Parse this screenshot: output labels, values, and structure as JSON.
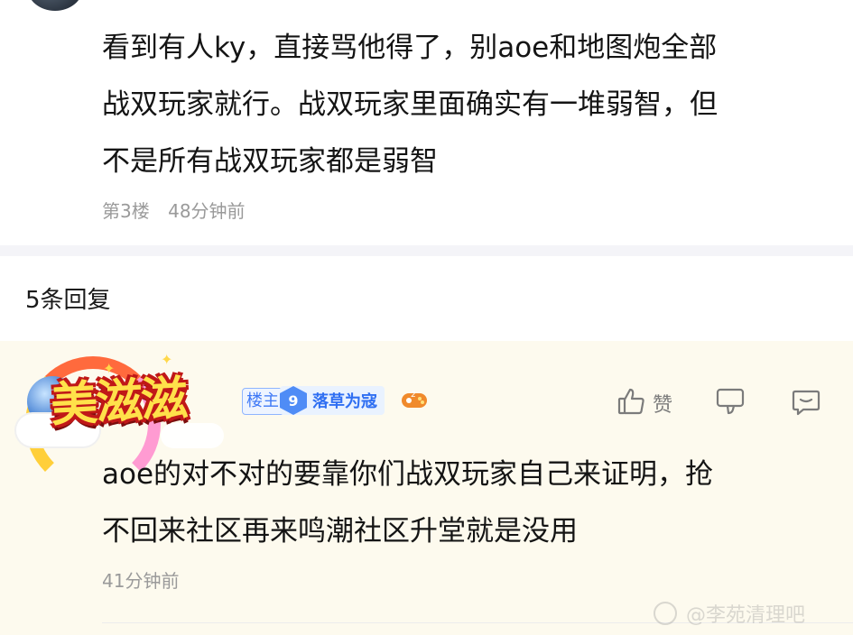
{
  "post": {
    "body_lines": [
      "看到有人ky，直接骂他得了，别aoe和地图炮全部",
      "战双玩家就行。战双玩家里面确实有一堆弱智，但",
      "不是所有战双玩家都是弱智"
    ],
    "floor": "第3楼",
    "time": "48分钟前"
  },
  "replies_header": "5条回复",
  "reply": {
    "avatar_badge_text": "美滋滋",
    "owner_tag": "楼主",
    "level_number": "9",
    "level_title": "落草为寇",
    "like_label": "赞",
    "body_lines": [
      "aoe的对不对的要靠你们战双玩家自己来证明，抢",
      "不回来社区再来鸣潮社区升堂就是没用"
    ],
    "time": "41分钟前"
  },
  "watermark": "@李苑清理吧",
  "icons": {
    "like": "thumbs-up-icon",
    "dislike": "thumbs-down-icon",
    "comment": "comment-icon",
    "game": "gamepad-icon"
  },
  "colors": {
    "reply_background": "#fdfaee",
    "accent_blue": "#3f79f6",
    "meta_gray": "#9a9a9a"
  }
}
